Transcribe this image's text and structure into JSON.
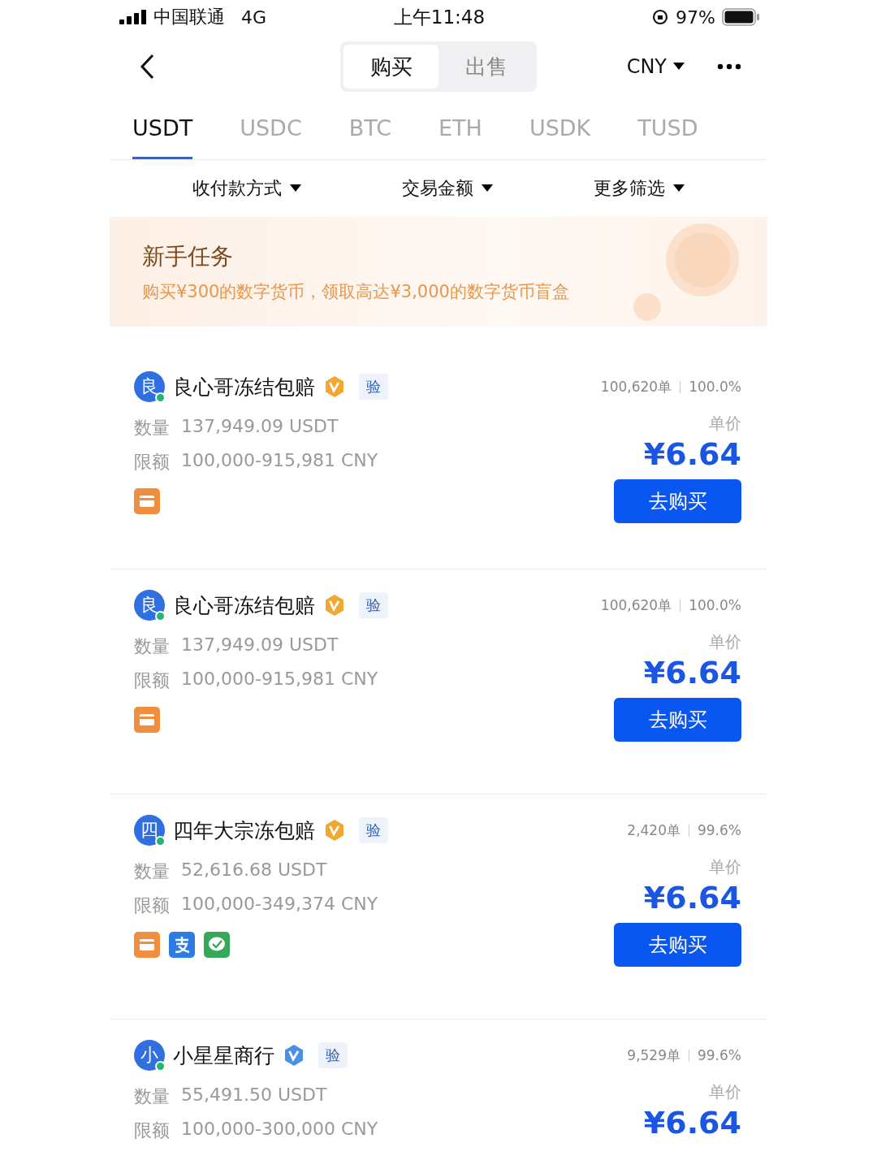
{
  "status_bar": {
    "carrier": "中国联通",
    "network": "4G",
    "time": "上午11:48",
    "battery": "97%"
  },
  "nav": {
    "segments": [
      {
        "label": "购买",
        "selected": true
      },
      {
        "label": "出售",
        "selected": false
      }
    ],
    "currency": "CNY"
  },
  "coin_tabs": [
    {
      "label": "USDT",
      "selected": true
    },
    {
      "label": "USDC",
      "selected": false
    },
    {
      "label": "BTC",
      "selected": false
    },
    {
      "label": "ETH",
      "selected": false
    },
    {
      "label": "USDK",
      "selected": false
    },
    {
      "label": "TUSD",
      "selected": false
    }
  ],
  "filters": [
    "收付款方式",
    "交易金额",
    "更多筛选"
  ],
  "banner": {
    "title": "新手任务",
    "text": "购买¥300的数字货币，领取高达¥3,000的数字货币盲盒"
  },
  "ads": [
    {
      "avatar": "良",
      "name": "良心哥冻结包赔",
      "badge": {
        "kind": "gold"
      },
      "verify": "验",
      "orders": "100,620单",
      "rate": "100.0%",
      "qty_label": "数量",
      "qty": "137,949.09 USDT",
      "limit_label": "限额",
      "limit": "100,000-915,981 CNY",
      "price_label": "单价",
      "price": "¥6.64",
      "button": "去购买",
      "payments": [
        {
          "kind": "card"
        }
      ]
    },
    {
      "avatar": "良",
      "name": "良心哥冻结包赔",
      "badge": {
        "kind": "gold"
      },
      "verify": "验",
      "orders": "100,620单",
      "rate": "100.0%",
      "qty_label": "数量",
      "qty": "137,949.09 USDT",
      "limit_label": "限额",
      "limit": "100,000-915,981 CNY",
      "price_label": "单价",
      "price": "¥6.64",
      "button": "去购买",
      "payments": [
        {
          "kind": "card"
        }
      ]
    },
    {
      "avatar": "四",
      "name": "四年大宗冻包赔",
      "badge": {
        "kind": "gold"
      },
      "verify": "验",
      "orders": "2,420单",
      "rate": "99.6%",
      "qty_label": "数量",
      "qty": "52,616.68 USDT",
      "limit_label": "限额",
      "limit": "100,000-349,374 CNY",
      "price_label": "单价",
      "price": "¥6.64",
      "button": "去购买",
      "payments": [
        {
          "kind": "card"
        },
        {
          "kind": "alipay"
        },
        {
          "kind": "wechat"
        }
      ]
    },
    {
      "avatar": "小",
      "name": "小星星商行",
      "badge": {
        "kind": "blue"
      },
      "verify": "验",
      "orders": "9,529单",
      "rate": "99.6%",
      "qty_label": "数量",
      "qty": "55,491.50 USDT",
      "limit_label": "限额",
      "limit": "100,000-300,000 CNY",
      "price_label": "单价",
      "price": "¥6.64"
    }
  ]
}
